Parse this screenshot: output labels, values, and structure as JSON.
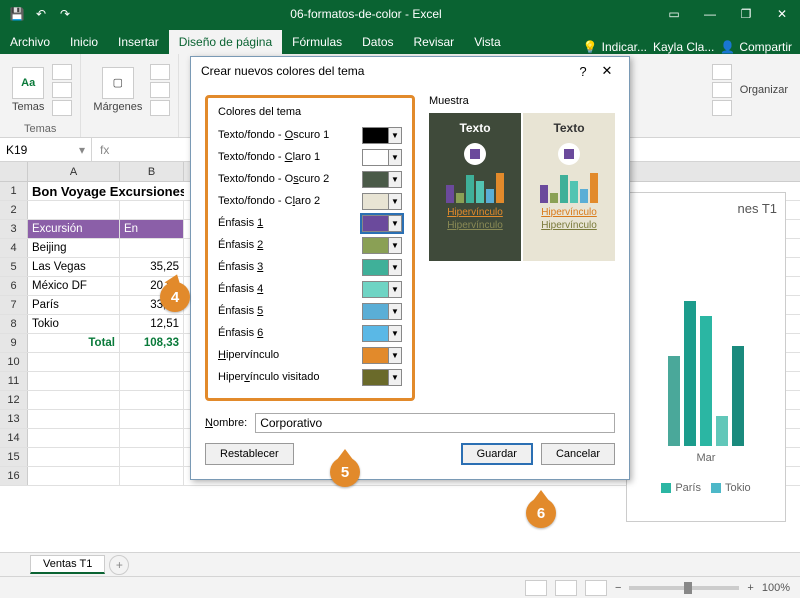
{
  "title": "06-formatos-de-color - Excel",
  "tabs": [
    "Archivo",
    "Inicio",
    "Insertar",
    "Diseño de página",
    "Fórmulas",
    "Datos",
    "Revisar",
    "Vista"
  ],
  "activeTab": 3,
  "tell": "Indicar...",
  "user": "Kayla Cla...",
  "share": "Compartir",
  "ribbon": {
    "temas": "Temas",
    "margenes": "Márgenes",
    "organizar": "Organizar",
    "temasGroup": "Temas"
  },
  "namebox": "K19",
  "columns": [
    "A",
    "B"
  ],
  "sheet": {
    "title": "Bon Voyage Excursiones",
    "header": [
      "Excursión",
      "En"
    ],
    "rows": [
      [
        "Beijing",
        ""
      ],
      [
        "Las Vegas",
        "35,25"
      ],
      [
        "México DF",
        "20,85"
      ],
      [
        "París",
        "33,71"
      ],
      [
        "Tokio",
        "12,51"
      ]
    ],
    "total": [
      "Total",
      "108,33"
    ]
  },
  "chart": {
    "title": "nes T1",
    "xlabel": "Mar",
    "legend": [
      "París",
      "Tokio"
    ]
  },
  "sheetTab": "Ventas T1",
  "zoom": "100%",
  "dialog": {
    "title": "Crear nuevos colores del tema",
    "groupColors": "Colores del tema",
    "groupSample": "Muestra",
    "rows": [
      {
        "label": "Texto/fondo - Oscuro 1",
        "u": "O",
        "color": "#000000"
      },
      {
        "label": "Texto/fondo - Claro 1",
        "u": "C",
        "color": "#ffffff"
      },
      {
        "label": "Texto/fondo - Oscuro 2",
        "u": "s",
        "color": "#4a5a48"
      },
      {
        "label": "Texto/fondo - Claro 2",
        "u": "l",
        "color": "#e8e4d4"
      },
      {
        "label": "Énfasis 1",
        "u": "1",
        "color": "#6b4a9c",
        "sel": true
      },
      {
        "label": "Énfasis 2",
        "u": "2",
        "color": "#8aa055"
      },
      {
        "label": "Énfasis 3",
        "u": "3",
        "color": "#3fb099"
      },
      {
        "label": "Énfasis 4",
        "u": "4",
        "color": "#6fd4c4"
      },
      {
        "label": "Énfasis 5",
        "u": "5",
        "color": "#5aaed6"
      },
      {
        "label": "Énfasis 6",
        "u": "6",
        "color": "#5ab8e6"
      },
      {
        "label": "Hipervínculo",
        "u": "H",
        "color": "#e28a2b"
      },
      {
        "label": "Hipervínculo visitado",
        "u": "v",
        "color": "#6a6a2a"
      }
    ],
    "sampleText": "Texto",
    "sampleLink": "Hipervínculo",
    "nameLabel": "Nombre:",
    "nameValue": "Corporativo",
    "reset": "Restablecer",
    "save": "Guardar",
    "cancel": "Cancelar"
  },
  "badges": {
    "b4": "4",
    "b5": "5",
    "b6": "6"
  }
}
